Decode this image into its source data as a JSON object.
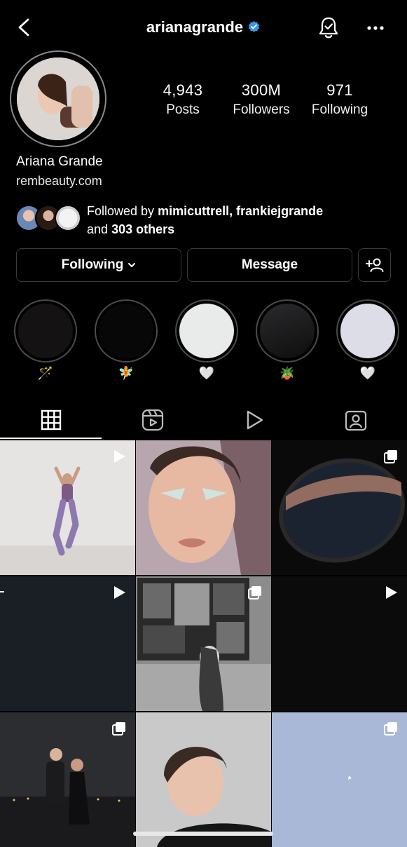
{
  "header": {
    "username": "arianagrande"
  },
  "profile": {
    "stats": [
      {
        "value": "4,943",
        "label": "Posts"
      },
      {
        "value": "300M",
        "label": "Followers"
      },
      {
        "value": "971",
        "label": "Following"
      }
    ],
    "full_name": "Ariana Grande",
    "website": "rembeauty.com",
    "followed_by_prefix": "Followed by",
    "followed_by_names": "mimicuttrell, frankiejgrande",
    "followed_by_and": "and",
    "followed_by_others": "303 others"
  },
  "actions": {
    "following_label": "Following",
    "message_label": "Message"
  },
  "highlights": [
    {
      "emoji": "🪄"
    },
    {
      "emoji": "🧚"
    },
    {
      "emoji": "🤍"
    },
    {
      "emoji": "🪴"
    },
    {
      "emoji": "🤍"
    }
  ],
  "tabs": [
    "grid-icon",
    "reels-icon",
    "video-icon",
    "tagged-icon"
  ],
  "colors": {
    "background": "#000000",
    "verified": "#3897f0",
    "border": "#3a3a3a"
  }
}
